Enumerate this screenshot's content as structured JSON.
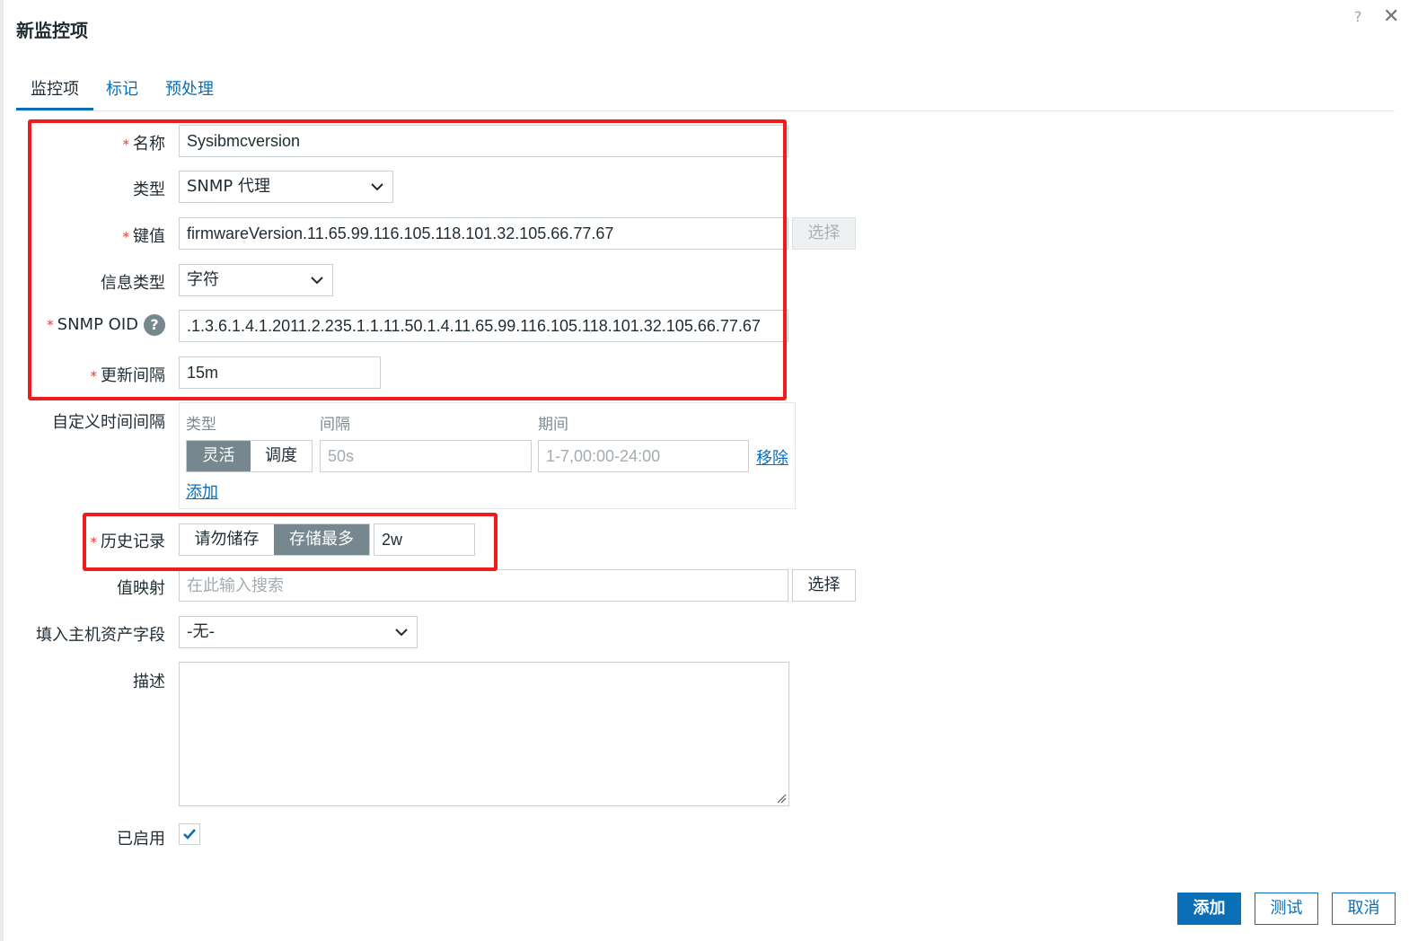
{
  "dialog": {
    "title": "新监控项",
    "help_glyph": "?",
    "close_glyph": "✕"
  },
  "tabs": [
    {
      "label": "监控项",
      "active": true
    },
    {
      "label": "标记",
      "active": false
    },
    {
      "label": "预处理",
      "active": false
    }
  ],
  "form": {
    "required_mark": "*",
    "name": {
      "label": "名称",
      "value": "Sysibmcversion"
    },
    "type": {
      "label": "类型",
      "value": "SNMP 代理"
    },
    "key": {
      "label": "键值",
      "value": "firmwareVersion.11.65.99.116.105.118.101.32.105.66.77.67",
      "select_button": "选择"
    },
    "info_type": {
      "label": "信息类型",
      "value": "字符"
    },
    "snmp_oid": {
      "label": "SNMP OID",
      "help_glyph": "?",
      "value": ".1.3.6.1.4.1.2011.2.235.1.1.11.50.1.4.11.65.99.116.105.118.101.32.105.66.77.67"
    },
    "update_interval": {
      "label": "更新间隔",
      "value": "15m"
    },
    "custom_intervals": {
      "label": "自定义时间间隔",
      "col_type": "类型",
      "col_interval": "间隔",
      "col_period": "期间",
      "type_options": [
        "灵活",
        "调度"
      ],
      "selected_type": "灵活",
      "interval_placeholder": "50s",
      "period_placeholder": "1-7,00:00-24:00",
      "remove_link": "移除",
      "add_link": "添加"
    },
    "history": {
      "label": "历史记录",
      "options": [
        "请勿储存",
        "存储最多"
      ],
      "selected": "存储最多",
      "value": "2w"
    },
    "value_map": {
      "label": "值映射",
      "placeholder": "在此输入搜索",
      "select_button": "选择"
    },
    "inventory": {
      "label": "填入主机资产字段",
      "value": "-无-"
    },
    "description": {
      "label": "描述",
      "value": ""
    },
    "enabled": {
      "label": "已启用",
      "checked": true
    }
  },
  "footer": {
    "add": "添加",
    "test": "测试",
    "cancel": "取消"
  },
  "colors": {
    "accent": "#0a6fb7",
    "highlight": "#ee1c1c",
    "segment_active": "#76878f"
  }
}
